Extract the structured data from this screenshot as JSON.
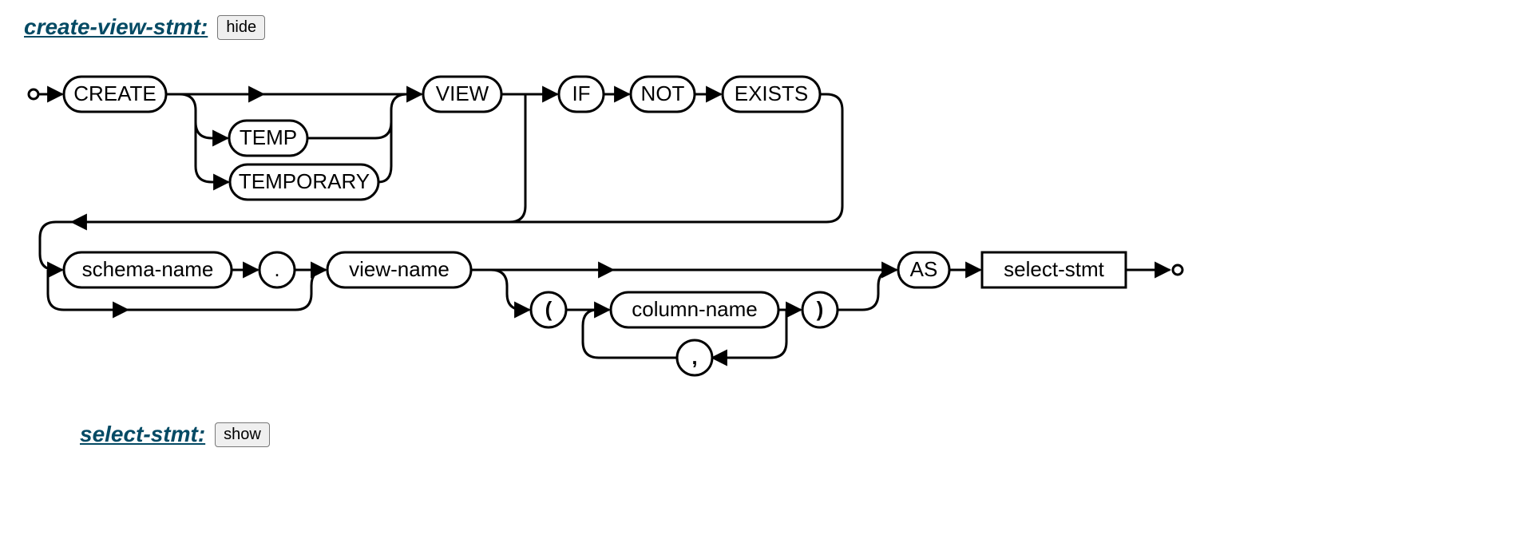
{
  "headings": {
    "create_view": {
      "label": "create-view-stmt:",
      "button": "hide"
    },
    "select_stmt": {
      "label": "select-stmt:",
      "button": "show"
    }
  },
  "diagram": {
    "nodes": {
      "create": "CREATE",
      "temp": "TEMP",
      "temporary": "TEMPORARY",
      "view": "VIEW",
      "if": "IF",
      "not": "NOT",
      "exists": "EXISTS",
      "schema_name": "schema-name",
      "dot": ".",
      "view_name": "view-name",
      "lparen": "(",
      "column_name": "column-name",
      "rparen": ")",
      "comma": ",",
      "as": "AS",
      "select_stmt": "select-stmt"
    }
  }
}
